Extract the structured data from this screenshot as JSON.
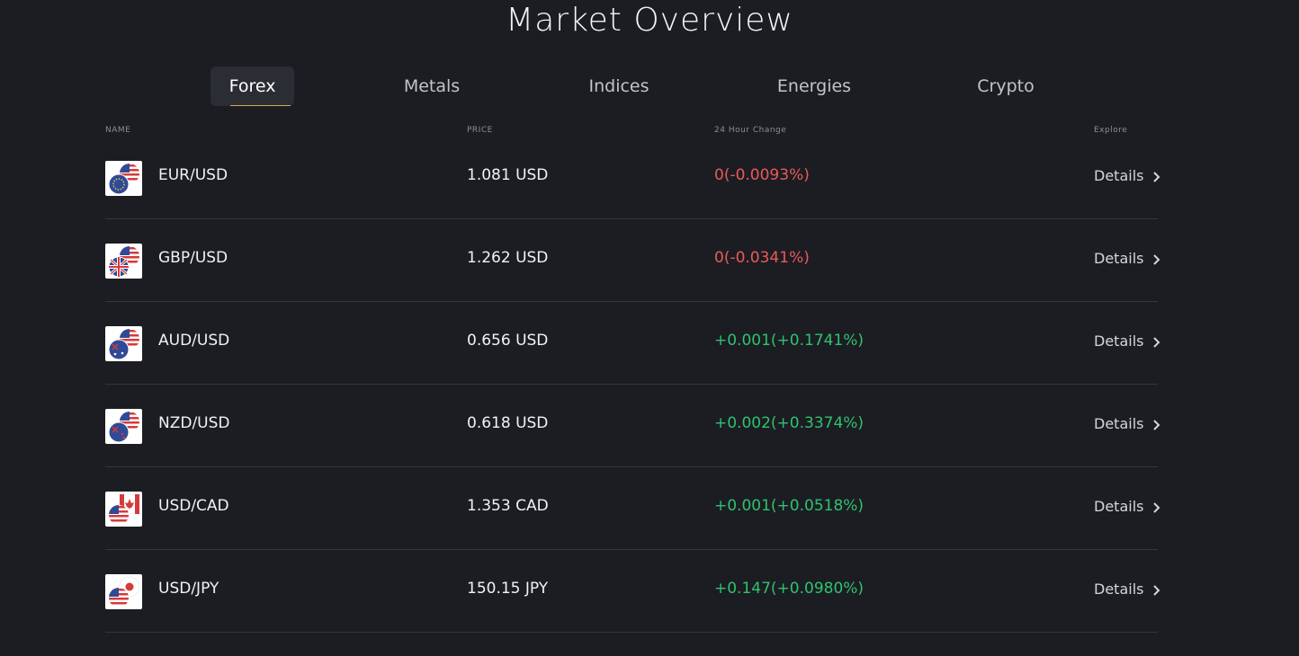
{
  "page": {
    "title": "Market Overview"
  },
  "tabs": [
    {
      "label": "Forex",
      "active": true
    },
    {
      "label": "Metals"
    },
    {
      "label": "Indices"
    },
    {
      "label": "Energies"
    },
    {
      "label": "Crypto"
    }
  ],
  "table": {
    "headers": {
      "name": "NAME",
      "price": "PRICE",
      "change": "24 Hour Change",
      "explore": "Explore"
    },
    "rows": [
      {
        "pair": "EUR/USD",
        "price": "1.081 USD",
        "change": "0(-0.0093%)",
        "direction": "down",
        "details": "Details",
        "icon": "eur-usd-flag-icon"
      },
      {
        "pair": "GBP/USD",
        "price": "1.262 USD",
        "change": "0(-0.0341%)",
        "direction": "down",
        "details": "Details",
        "icon": "gbp-usd-flag-icon"
      },
      {
        "pair": "AUD/USD",
        "price": "0.656 USD",
        "change": "+0.001(+0.1741%)",
        "direction": "up",
        "details": "Details",
        "icon": "aud-usd-flag-icon"
      },
      {
        "pair": "NZD/USD",
        "price": "0.618 USD",
        "change": "+0.002(+0.3374%)",
        "direction": "up",
        "details": "Details",
        "icon": "nzd-usd-flag-icon"
      },
      {
        "pair": "USD/CAD",
        "price": "1.353 CAD",
        "change": "+0.001(+0.0518%)",
        "direction": "up",
        "details": "Details",
        "icon": "usd-cad-flag-icon"
      },
      {
        "pair": "USD/JPY",
        "price": "150.15 JPY",
        "change": "+0.147(+0.0980%)",
        "direction": "up",
        "details": "Details",
        "icon": "usd-jpy-flag-icon"
      }
    ]
  },
  "colors": {
    "background": "#1c1d23",
    "negative": "#e85a5a",
    "positive": "#2fc26e",
    "tab_underline": "#d6a94a"
  }
}
